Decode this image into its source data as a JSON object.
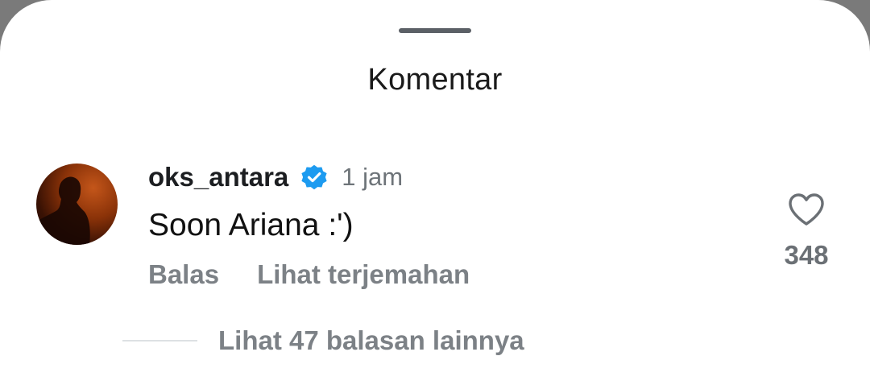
{
  "sheet": {
    "title": "Komentar"
  },
  "comment": {
    "username": "oks_antara",
    "verified_icon": "verified-badge-icon",
    "timestamp": "1 jam",
    "text": "Soon Ariana :')",
    "actions": {
      "reply_label": "Balas",
      "translate_label": "Lihat terjemahan"
    },
    "likes": {
      "icon": "heart-outline-icon",
      "count": "348"
    },
    "replies": {
      "label": "Lihat 47 balasan lainnya"
    }
  },
  "colors": {
    "verified": "#1d9bf0",
    "secondary_text": "#7c8186",
    "primary_text": "#111111"
  }
}
